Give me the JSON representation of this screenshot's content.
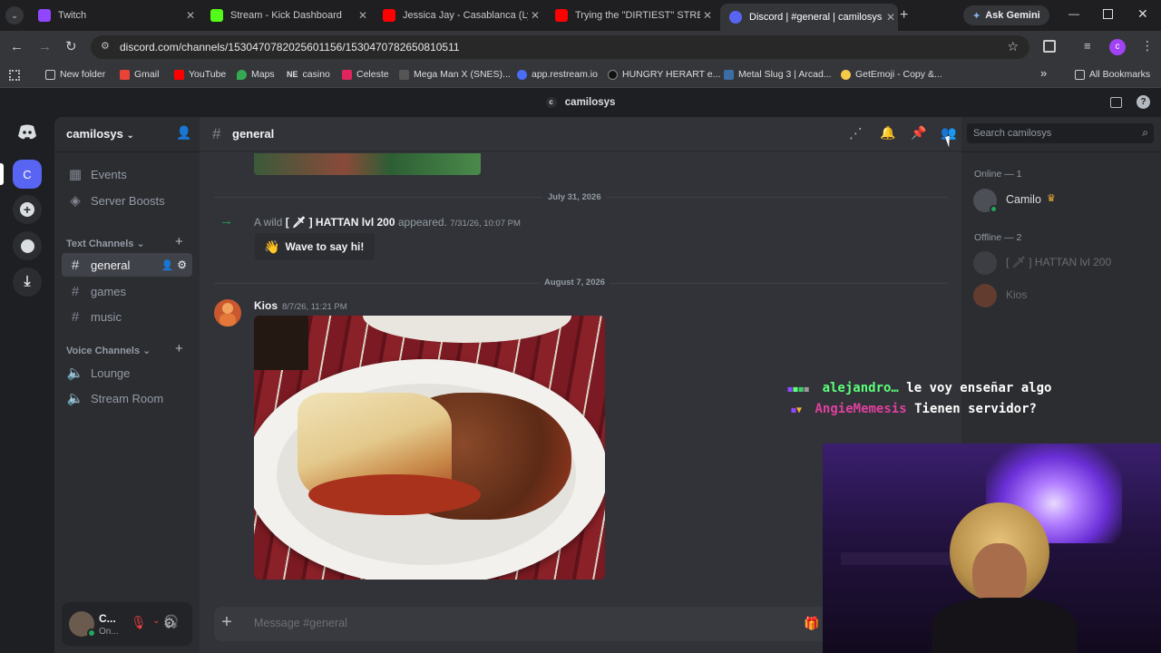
{
  "browser": {
    "tabs": [
      {
        "label": "Twitch",
        "color": "#9146ff"
      },
      {
        "label": "Stream - Kick Dashboard",
        "color": "#53fc18"
      },
      {
        "label": "Jessica Jay - Casablanca (Lyric",
        "color": "#ff0000"
      },
      {
        "label": "Trying the \"DIRTIEST\" STREET",
        "color": "#ff0000"
      },
      {
        "label": "Discord | #general | camilosys",
        "color": "#5865f2"
      }
    ],
    "ask_gemini": "Ask Gemini",
    "url": "discord.com/channels/1530470782025601156/1530470782650810511",
    "bookmarks": [
      {
        "label": "New folder",
        "color": "#c8c8c8"
      },
      {
        "label": "Gmail",
        "color": "#ea4335"
      },
      {
        "label": "YouTube",
        "color": "#ff0000"
      },
      {
        "label": "Maps",
        "color": "#34a853"
      },
      {
        "label": "casino",
        "color": "#333333"
      },
      {
        "label": "Celeste",
        "color": "#e0245e"
      },
      {
        "label": "Mega Man X (SNES)...",
        "color": "#555555"
      },
      {
        "label": "app.restream.io",
        "color": "#4a6cf7"
      },
      {
        "label": "HUNGRY HERART e...",
        "color": "#222222"
      },
      {
        "label": "Metal Slug 3 | Arcad...",
        "color": "#3a6ea5"
      },
      {
        "label": "GetEmoji - Copy &...",
        "color": "#f7c948"
      }
    ],
    "bookmark_more": "»",
    "all_bookmarks": "All Bookmarks",
    "ne_prefix": "NE"
  },
  "discord": {
    "window_title": "camilosys",
    "server_initial": "C",
    "server_name": "camilosys",
    "nav": [
      {
        "label": "Events"
      },
      {
        "label": "Server Boosts"
      }
    ],
    "text_category": "Text Channels",
    "text_channels": [
      {
        "label": "general"
      },
      {
        "label": "games"
      },
      {
        "label": "music"
      }
    ],
    "voice_category": "Voice Channels",
    "voice_channels": [
      {
        "label": "Lounge"
      },
      {
        "label": "Stream Room"
      }
    ],
    "user": {
      "name": "C...",
      "status": "On..."
    },
    "channel_header": "general",
    "search_placeholder": "Search camilosys",
    "messages": {
      "date1": "July 31, 2026",
      "join_prefix": "A wild",
      "join_user": "[ 🗡 ] HATTAN lvl 200",
      "join_suffix": "appeared.",
      "join_time": "7/31/26, 10:07 PM",
      "wave_label": "Wave to say hi!",
      "date2": "August 7, 2026",
      "author": "Kios",
      "author_time": "8/7/26, 11:21 PM"
    },
    "composer_placeholder": "Message #general",
    "members": {
      "online_header": "Online — 1",
      "online": [
        {
          "name": "Camilo"
        }
      ],
      "offline_header": "Offline — 2",
      "offline": [
        {
          "name": "[ 🗡 ] HATTAN lvl 200"
        },
        {
          "name": "Kios"
        }
      ]
    }
  },
  "stream_overlay": {
    "chat": [
      {
        "user": "alejandro…",
        "text": "le voy enseñar algo",
        "user_color": "#5cff7a"
      },
      {
        "user": "AngieMemesis",
        "text": "Tienen servidor?",
        "user_color": "#e0409e"
      }
    ]
  }
}
